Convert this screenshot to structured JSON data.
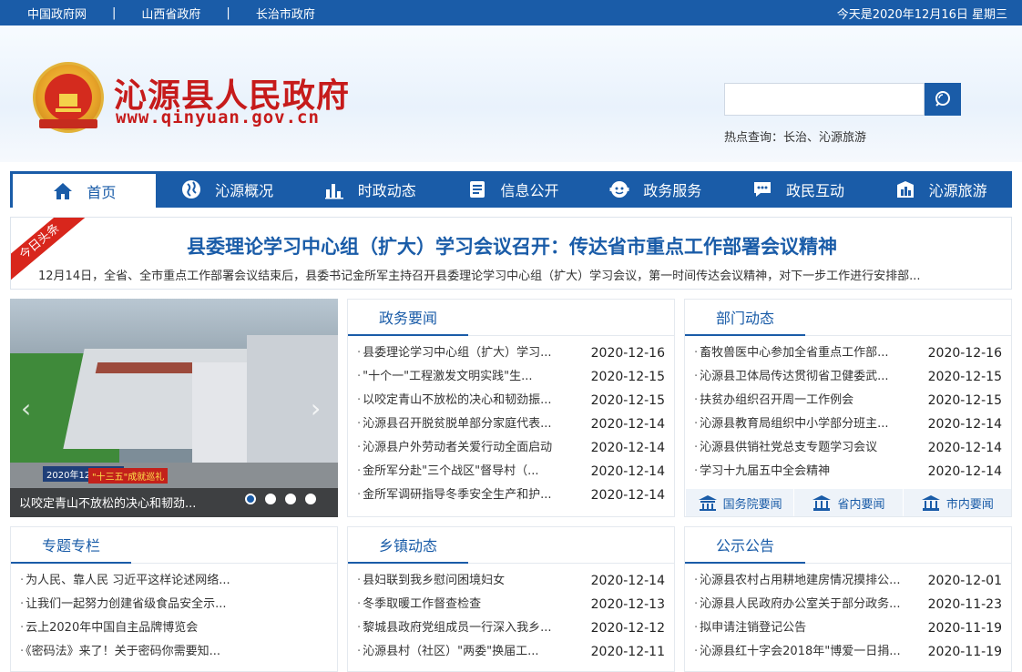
{
  "topbar": {
    "links": [
      "中国政府网",
      "山西省政府",
      "长治市政府"
    ],
    "date": "今天是2020年12月16日 星期三"
  },
  "header": {
    "title": "沁源县人民政府",
    "url": "www.qinyuan.gov.cn",
    "search_placeholder": "",
    "hot_text": "热点查询：长治、沁源旅游"
  },
  "nav": {
    "items": [
      {
        "label": "首页",
        "icon": "home-icon"
      },
      {
        "label": "沁源概况",
        "icon": "globe-icon"
      },
      {
        "label": "时政动态",
        "icon": "chart-icon"
      },
      {
        "label": "信息公开",
        "icon": "document-icon"
      },
      {
        "label": "政务服务",
        "icon": "service-icon"
      },
      {
        "label": "政民互动",
        "icon": "chat-icon"
      },
      {
        "label": "沁源旅游",
        "icon": "scenery-icon"
      }
    ]
  },
  "headline": {
    "badge": "今日头条",
    "title": "县委理论学习中心组（扩大）学习会议召开：传达省市重点工作部署会议精神",
    "summary": "12月14日，全省、全市重点工作部署会议结束后，县委书记金所军主持召开县委理论学习中心组（扩大）学习会议，第一时间传达会议精神，对下一步工作进行安排部..."
  },
  "carousel": {
    "caption": "以咬定青山不放松的决心和韧劲...",
    "tag_date": "2020年12月14日",
    "tag_label": "\"十三五\"成就巡礼",
    "dots": 4,
    "active_dot": 0
  },
  "zhengwu": {
    "title": "政务要闻",
    "items": [
      {
        "t": "县委理论学习中心组（扩大）学习...",
        "d": "2020-12-16"
      },
      {
        "t": "\"十个一\"工程激发文明实践\"生...",
        "d": "2020-12-15"
      },
      {
        "t": "以咬定青山不放松的决心和韧劲振...",
        "d": "2020-12-15"
      },
      {
        "t": "沁源县召开脱贫脱单部分家庭代表...",
        "d": "2020-12-14"
      },
      {
        "t": "沁源县户外劳动者关爱行动全面启动",
        "d": "2020-12-14"
      },
      {
        "t": "金所军分赴\"三个战区\"督导村（...",
        "d": "2020-12-14"
      },
      {
        "t": "金所军调研指导冬季安全生产和护...",
        "d": "2020-12-14"
      }
    ]
  },
  "bumen": {
    "title": "部门动态",
    "items": [
      {
        "t": "畜牧兽医中心参加全省重点工作部...",
        "d": "2020-12-16"
      },
      {
        "t": "沁源县卫体局传达贯彻省卫健委武...",
        "d": "2020-12-15"
      },
      {
        "t": "扶贫办组织召开周一工作例会",
        "d": "2020-12-15"
      },
      {
        "t": "沁源县教育局组织中小学部分班主...",
        "d": "2020-12-14"
      },
      {
        "t": "沁源县供销社党总支专题学习会议",
        "d": "2020-12-14"
      },
      {
        "t": "学习十九届五中全会精神",
        "d": "2020-12-14"
      }
    ],
    "subtabs": [
      "国务院要闻",
      "省内要闻",
      "市内要闻"
    ]
  },
  "zhuanti": {
    "title": "专题专栏",
    "items": [
      "为人民、靠人民 习近平这样论述网络...",
      "让我们一起努力创建省级食品安全示...",
      "云上2020年中国自主品牌博览会",
      "《密码法》来了！关于密码你需要知..."
    ]
  },
  "xiangzhen": {
    "title": "乡镇动态",
    "items": [
      {
        "t": "县妇联到我乡慰问困境妇女",
        "d": "2020-12-14"
      },
      {
        "t": "冬季取暖工作督查检查",
        "d": "2020-12-13"
      },
      {
        "t": "黎城县政府党组成员一行深入我乡...",
        "d": "2020-12-12"
      },
      {
        "t": "沁源县村（社区）\"两委\"换届工...",
        "d": "2020-12-11"
      }
    ]
  },
  "gonggao": {
    "title": "公示公告",
    "items": [
      {
        "t": "沁源县农村占用耕地建房情况摸排公...",
        "d": "2020-12-01"
      },
      {
        "t": "沁源县人民政府办公室关于部分政务...",
        "d": "2020-11-23"
      },
      {
        "t": "拟申请注销登记公告",
        "d": "2020-11-19"
      },
      {
        "t": "沁源县红十字会2018年\"博爱一日捐...",
        "d": "2020-11-19"
      }
    ]
  },
  "colors": {
    "primary": "#1a5ca8",
    "title_red": "#c61b1b",
    "badge_red": "#d8261c"
  }
}
